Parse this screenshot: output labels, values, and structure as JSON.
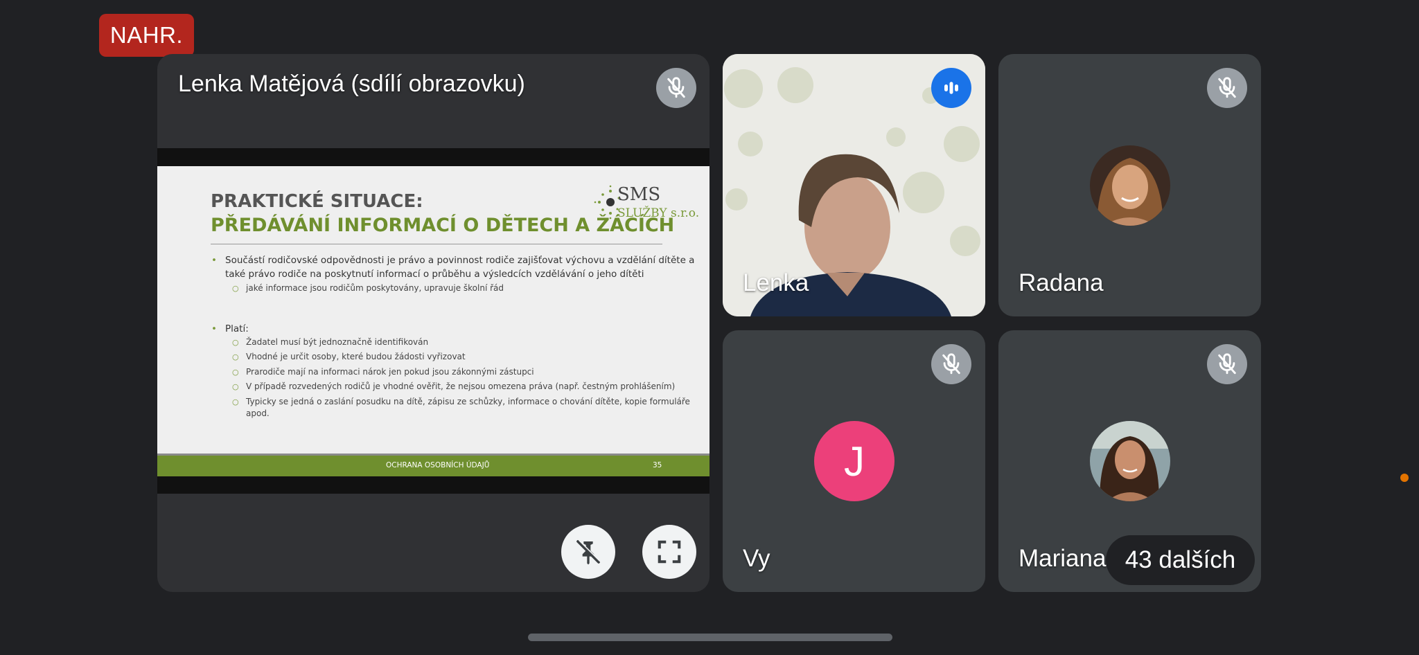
{
  "recording_badge": "NAHR.",
  "presenter": {
    "name": "Lenka Matějová (sdílí obrazovku)",
    "slide": {
      "title_line1": "PRAKTICKÉ SITUACE:",
      "title_line2": "PŘEDÁVÁNÍ INFORMACÍ O DĚTECH A ŽÁCÍCH",
      "logo_main": "SMS",
      "logo_sub": "SLUŽBY s.r.o.",
      "bullet1_line1": "Součástí rodičovské odpovědnosti je právo a povinnost rodiče zajišťovat výchovu a vzdělání dítěte a",
      "bullet1_line2": "také právo rodiče na poskytnutí informací o průběhu a výsledcích vzdělávání o jeho dítěti",
      "bullet1_sub": "jaké informace jsou rodičům poskytovány, upravuje školní řád",
      "bullet2": "Platí:",
      "bullet2_subs": [
        "Žadatel musí být jednoznačně identifikován",
        "Vhodné je určit osoby, které budou žádosti vyřizovat",
        "Prarodiče mají na informaci nárok jen pokud jsou zákonnými zástupci",
        "V případě rozvedených rodičů je vhodné ověřit, že nejsou omezena práva (např. čestným prohlášením)",
        "Typicky se jedná o zaslání posudku na dítě, zápisu ze schůzky, informace o chování dítěte, kopie formuláře",
        "apod."
      ],
      "footer": "OCHRANA OSOBNÍCH ÚDAJŮ",
      "page_number": "35"
    }
  },
  "participants": {
    "lenka": "Lenka",
    "radana": "Radana",
    "you": "Vy",
    "you_initial": "J",
    "mariana": "Mariana"
  },
  "more_participants": "43 dalších",
  "icons": {
    "muted": "mic-off-icon",
    "speaking": "audio-level-icon",
    "unpin": "pin-off-icon",
    "fullscreen": "fullscreen-icon"
  },
  "colors": {
    "background": "#202124",
    "tile": "#3c4043",
    "recording": "#b3261e",
    "speaking": "#1a73e8",
    "avatar_you": "#ec407a",
    "slide_accent": "#6f8f2e"
  }
}
